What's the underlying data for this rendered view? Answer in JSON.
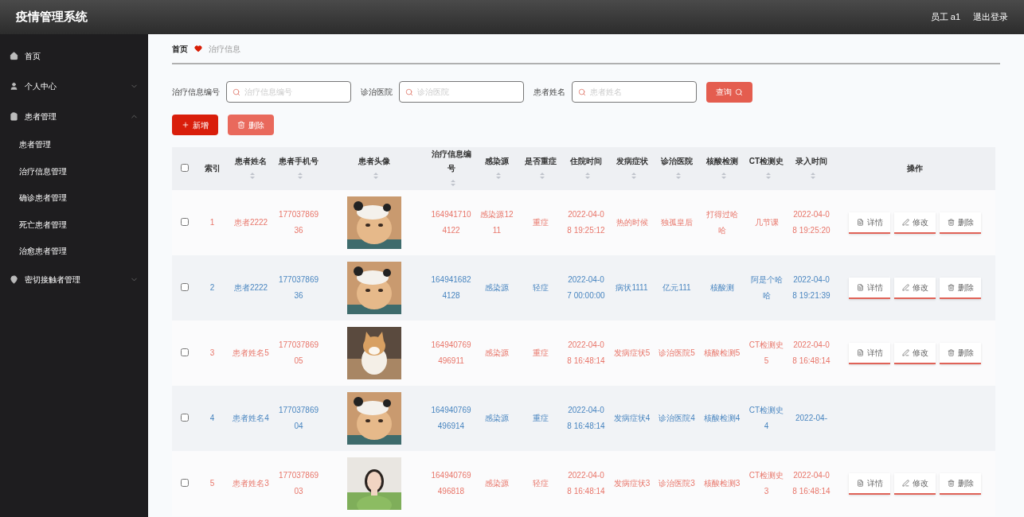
{
  "header": {
    "title": "疫情管理系统",
    "user": "员工 a1",
    "logout": "退出登录"
  },
  "sidebar": {
    "items": [
      {
        "label": "首页",
        "kind": "home"
      },
      {
        "label": "个人中心",
        "kind": "user",
        "expanded": false
      },
      {
        "label": "患者管理",
        "kind": "clipboard",
        "expanded": true,
        "children": [
          {
            "label": "患者管理"
          },
          {
            "label": "治疗信息管理"
          },
          {
            "label": "确诊患者管理"
          },
          {
            "label": "死亡患者管理"
          },
          {
            "label": "治愈患者管理"
          }
        ]
      },
      {
        "label": "密切接触者管理",
        "kind": "pin",
        "expanded": false
      }
    ]
  },
  "breadcrumb": {
    "home": "首页",
    "current": "治疗信息"
  },
  "filters": [
    {
      "label": "治疗信息编号",
      "placeholder": "治疗信息编号"
    },
    {
      "label": "诊治医院",
      "placeholder": "诊治医院"
    },
    {
      "label": "患者姓名",
      "placeholder": "患者姓名"
    }
  ],
  "search_button": "查询",
  "actions": {
    "add": "新增",
    "delete": "删除"
  },
  "table": {
    "header_checked": false,
    "columns": [
      {
        "label": "索引",
        "sortable": false
      },
      {
        "label": "患者姓名",
        "sortable": true
      },
      {
        "label": "患者手机号",
        "sortable": true
      },
      {
        "label": "患者头像",
        "sortable": true
      },
      {
        "label": "治疗信息编号",
        "sortable": true
      },
      {
        "label": "感染源",
        "sortable": true
      },
      {
        "label": "是否重症",
        "sortable": true
      },
      {
        "label": "住院时间",
        "sortable": true
      },
      {
        "label": "发病症状",
        "sortable": true
      },
      {
        "label": "诊治医院",
        "sortable": true
      },
      {
        "label": "核酸检测",
        "sortable": true
      },
      {
        "label": "CT检测史",
        "sortable": true
      },
      {
        "label": "录入时间",
        "sortable": true
      },
      {
        "label": "操作",
        "sortable": false
      }
    ],
    "rows": [
      {
        "checked": false,
        "color": "#e8766a",
        "cells": [
          "1",
          "患者2222",
          "17703786936",
          {
            "kind": "picture"
          },
          "1649417104122",
          "感染源1211",
          "重症",
          "2022-04-08 19:25:12",
          "热的时候",
          "独孤皇后",
          "打得过哈哈",
          "几节课",
          "2022-04-08 19:25:20"
        ],
        "buttons": [
          "详情",
          "修改",
          "删除"
        ]
      },
      {
        "checked": false,
        "color": "#4a86c0",
        "cells": [
          "2",
          "患者2222",
          "17703786936",
          {
            "kind": "picture"
          },
          "1649416824128",
          "感染源",
          "轻症",
          "2022-04-07 00:00:00",
          "病状1111",
          "亿元111",
          "核酸测",
          "阿是个哈哈",
          "2022-04-08 19:21:39"
        ],
        "buttons": [
          "详情",
          "修改",
          "删除"
        ]
      },
      {
        "checked": false,
        "color": "#e8766a",
        "cells": [
          "3",
          "患者姓名5",
          "17703786905",
          {
            "kind": "picture"
          },
          "164940769496911",
          "感染源",
          "重症",
          "2022-04-08 16:48:14",
          "发病症状5",
          "诊治医院5",
          "核酸检测5",
          "CT检测史5",
          "2022-04-08 16:48:14"
        ],
        "buttons": [
          "详情",
          "修改",
          "删除"
        ]
      },
      {
        "checked": false,
        "color": "#4a86c0",
        "cells": [
          "4",
          "患者姓名4",
          "17703786904",
          {
            "kind": "picture"
          },
          "164940769496914",
          "感染源",
          "重症",
          "2022-04-08 16:48:14",
          "发病症状4",
          "诊治医院4",
          "核酸检测4",
          "CT检测史4",
          "2022-04-"
        ],
        "buttons": []
      },
      {
        "checked": false,
        "color": "#e8766a",
        "cells": [
          "5",
          "患者姓名3",
          "17703786903",
          {
            "kind": "picture"
          },
          "164940769496818",
          "感染源",
          "轻症",
          "2022-04-08 16:48:14",
          "发病症状3",
          "诊治医院3",
          "核酸检测3",
          "CT检测史3",
          "2022-04-08 16:48:14"
        ],
        "buttons": [
          "详情",
          "修改",
          "删除"
        ]
      }
    ]
  }
}
